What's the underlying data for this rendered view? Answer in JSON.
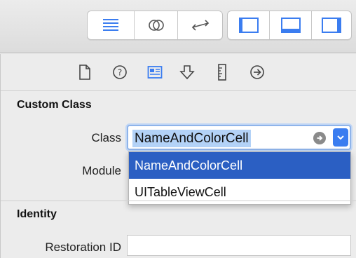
{
  "toolbar": {
    "editor_buttons": [
      "standard-editor-icon",
      "assistant-editor-icon",
      "version-editor-icon"
    ],
    "view_buttons": [
      "navigator-panel-icon",
      "debug-area-icon",
      "utilities-panel-icon"
    ],
    "active_color": "#3b7df0"
  },
  "inspector_tabs": [
    "file-inspector-icon",
    "quick-help-icon",
    "identity-inspector-icon",
    "attributes-inspector-icon",
    "size-inspector-icon",
    "connections-inspector-icon"
  ],
  "custom_class": {
    "title": "Custom Class",
    "class_label": "Class",
    "class_value": "NameAndColorCell",
    "module_label": "Module",
    "options": [
      {
        "label": "NameAndColorCell",
        "selected": true
      },
      {
        "label": "UITableViewCell",
        "selected": false
      }
    ]
  },
  "identity": {
    "title": "Identity",
    "restoration_label": "Restoration ID",
    "restoration_value": ""
  }
}
